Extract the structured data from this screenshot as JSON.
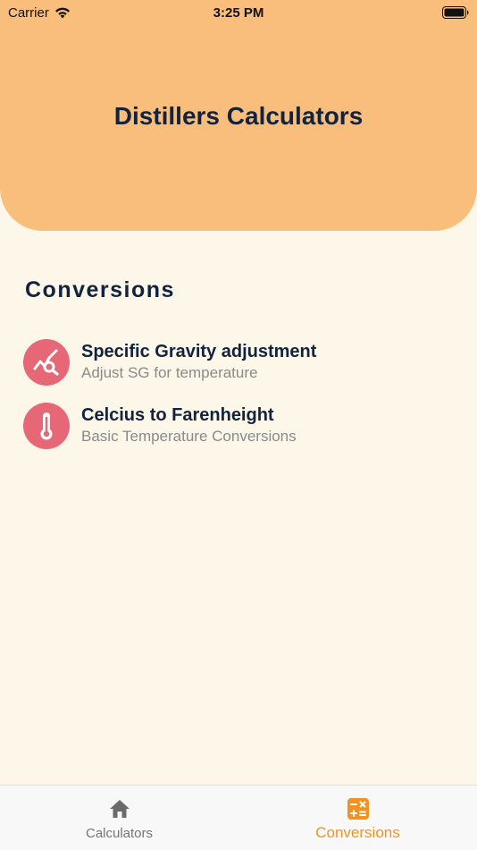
{
  "status_bar": {
    "carrier": "Carrier",
    "time": "3:25 PM"
  },
  "header": {
    "title": "Distillers Calculators",
    "color": "#f9bd7c"
  },
  "section": {
    "title": "Conversions"
  },
  "items": [
    {
      "title": "Specific Gravity adjustment",
      "subtitle": "Adjust SG for temperature",
      "icon": "chart-search-icon"
    },
    {
      "title": "Celcius to Farenheight",
      "subtitle": "Basic Temperature Conversions",
      "icon": "thermometer-icon"
    }
  ],
  "tabs": [
    {
      "label": "Calculators",
      "icon": "home-icon",
      "active": false
    },
    {
      "label": "Conversions",
      "icon": "calculator-icon",
      "active": true
    }
  ],
  "colors": {
    "accent": "#f19321",
    "icon_bg": "#e66876",
    "background": "#fdf7e9",
    "text": "#12233d"
  }
}
